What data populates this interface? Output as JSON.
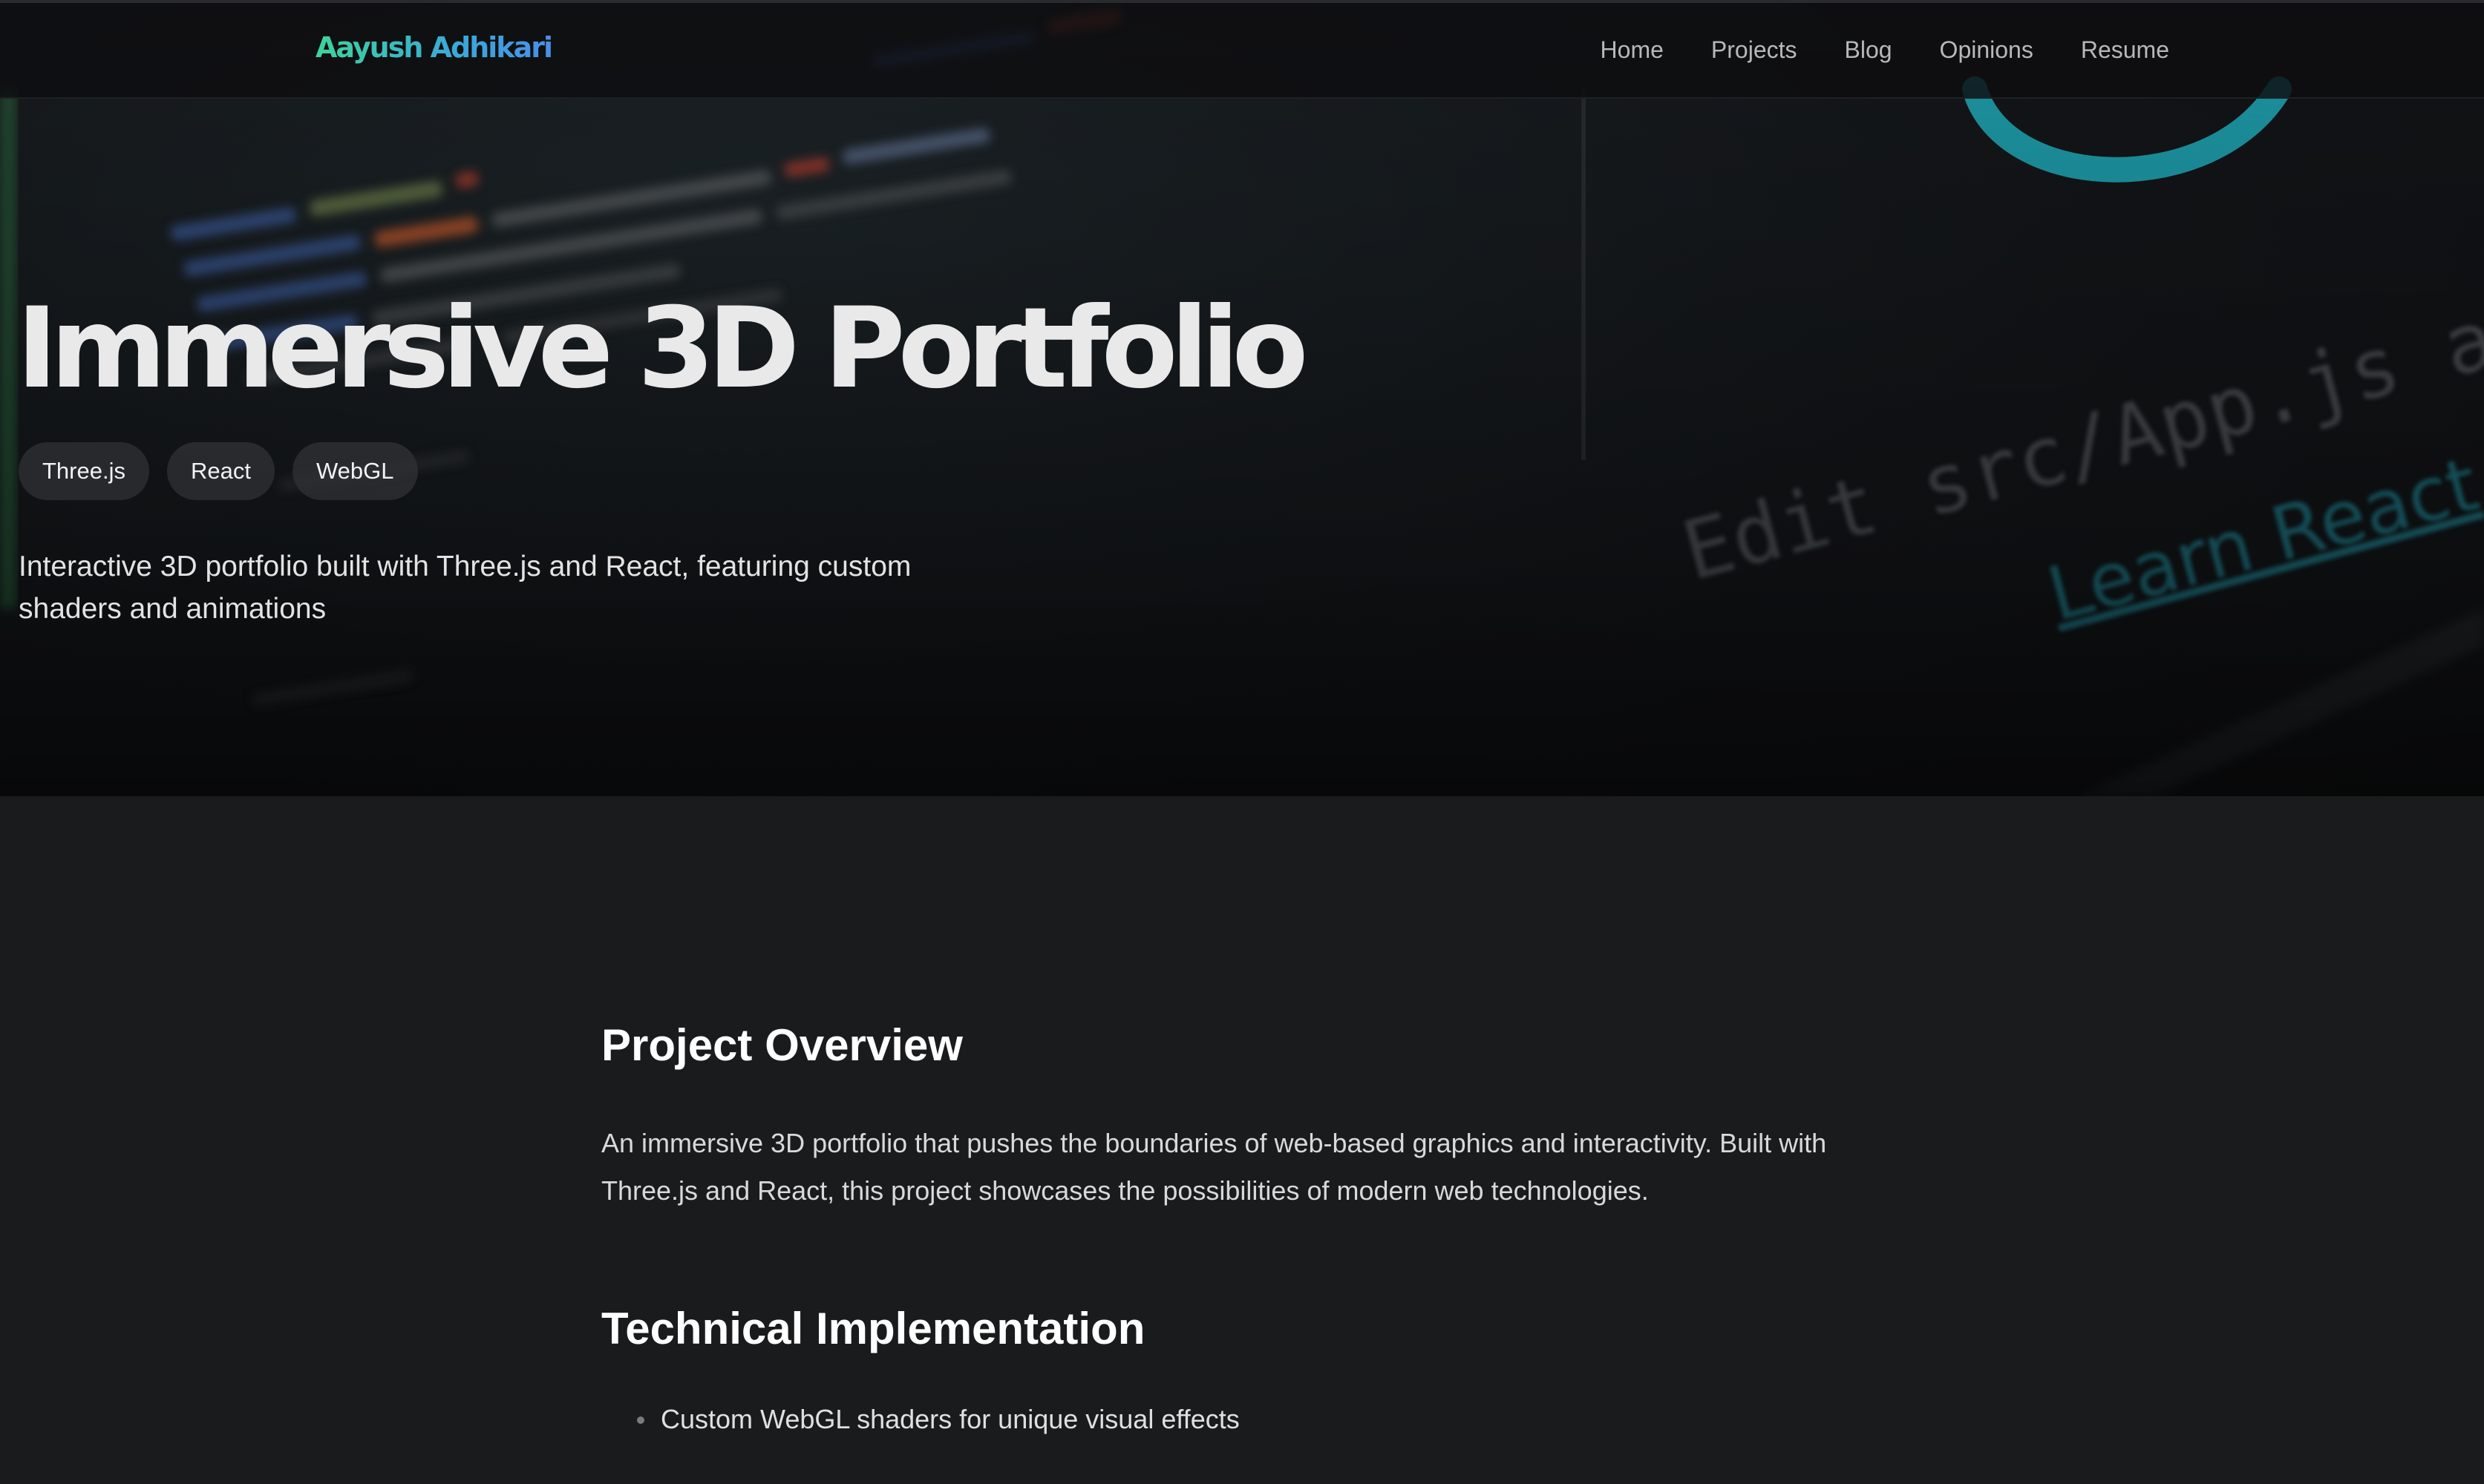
{
  "nav": {
    "brand": "Aayush Adhikari",
    "links": [
      "Home",
      "Projects",
      "Blog",
      "Opinions",
      "Resume"
    ]
  },
  "hero": {
    "title": "Immersive 3D Portfolio",
    "tags": [
      "Three.js",
      "React",
      "WebGL"
    ],
    "description": "Interactive 3D portfolio built with Three.js and React, featuring custom shaders and animations",
    "background": {
      "code_text": "Edit src/App.js and save to rel",
      "link_text": "Learn React"
    }
  },
  "article": {
    "overview_heading": "Project Overview",
    "overview_text": "An immersive 3D portfolio that pushes the boundaries of web-based graphics and interactivity. Built with Three.js and React, this project showcases the possibilities of modern web technologies.",
    "tech_heading": "Technical Implementation",
    "features": [
      "Custom WebGL shaders for unique visual effects"
    ]
  },
  "colors": {
    "page_background": "#1a1b1d",
    "brand_gradient_start": "#3fd39a",
    "brand_gradient_end": "#4a8fe8",
    "react_teal": "#1fa9b8"
  }
}
